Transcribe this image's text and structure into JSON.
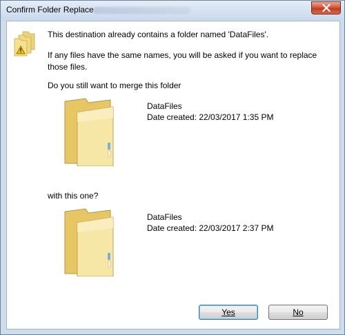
{
  "window": {
    "title": "Confirm Folder Replace",
    "close_glyph": "✕"
  },
  "message": {
    "line1": "This destination already contains a folder named 'DataFiles'.",
    "line2": "If any files have the same names, you will be asked if you want to replace those files.",
    "line3": "Do you still want to merge this folder"
  },
  "source_folder": {
    "name": "DataFiles",
    "date_created": "Date created: 22/03/2017 1:35 PM",
    "icon": "folder-icon"
  },
  "separator_text": "with this one?",
  "dest_folder": {
    "name": "DataFiles",
    "date_created": "Date created: 22/03/2017 2:37 PM",
    "icon": "folder-icon"
  },
  "buttons": {
    "yes_label": "Yes",
    "no_label": "No"
  },
  "icons": {
    "warning": "folder-warning-icon"
  },
  "colors": {
    "titlebar": "#d6e3f2",
    "close_button": "#c13c1f",
    "default_button_border": "#3c7fb1",
    "folder": "#f3d77a"
  }
}
